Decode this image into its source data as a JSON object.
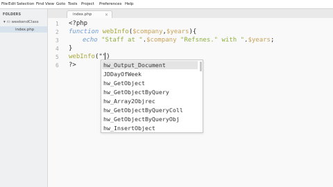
{
  "menu": [
    "File",
    "Edit",
    "Selection",
    "Find",
    "View",
    "Goto",
    "Tools",
    "Project",
    "Preferences",
    "Help"
  ],
  "sidebar": {
    "title": "FOLDERS",
    "folder": "weekendClass",
    "file": "index.php"
  },
  "tab": {
    "label": "index.php",
    "close": "×"
  },
  "editor": {
    "line_numbers": [
      "1",
      "2",
      "3",
      "4",
      "5",
      "6"
    ],
    "line1": "<?php",
    "line2": {
      "kw": "function",
      "name": "webInfo",
      "open": "(",
      "p1": "$company",
      "comma": ",",
      "p2": "$years",
      "close": "){"
    },
    "line3": {
      "kw": "echo",
      "s1": "\"Staff at \"",
      "dot1": ".",
      "v1": "$company",
      "s2": " \"Refsnes.\"",
      "s3": " with \"",
      "dot2": ".",
      "v2": "$years",
      "end": ";"
    },
    "line4": "}",
    "line5": {
      "name": "webInfo",
      "args": "(\"\")"
    },
    "line6": "?>"
  },
  "autocomplete": {
    "items": [
      "hw_Output_Document",
      "JDDayOfWeek",
      "hw_GetObject",
      "hw_GetObjectByQuery",
      "hw_Array2Objrec",
      "hw_GetObjectByQueryColl",
      "hw_GetObjectByQueryObj",
      "hw_InsertObject"
    ]
  }
}
